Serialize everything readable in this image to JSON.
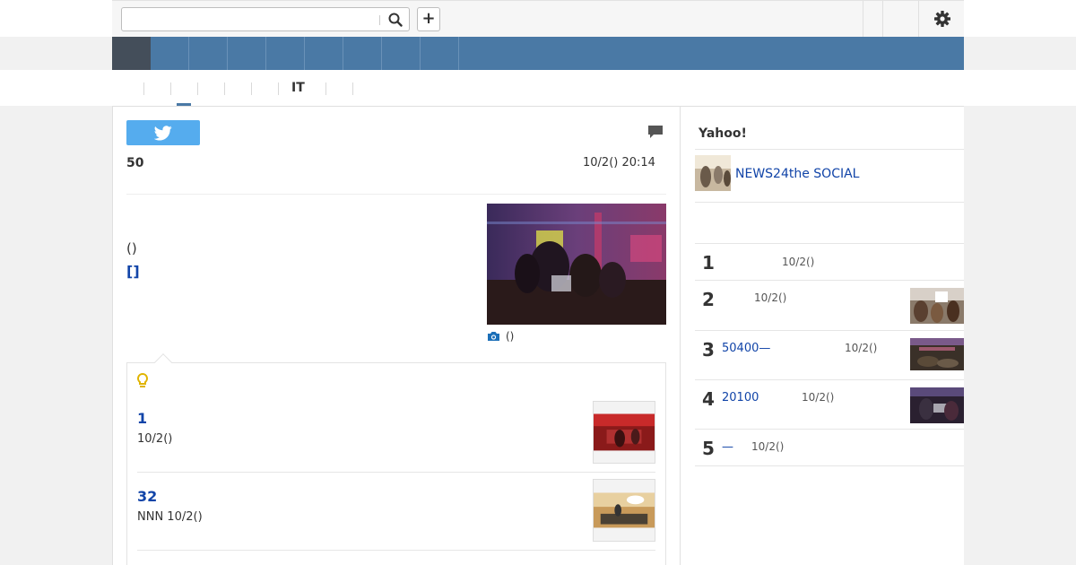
{
  "header": {
    "search": {
      "value": "",
      "placeholder": ""
    },
    "search_icon": "search-icon",
    "add_label": "+",
    "settings_icon": "gear-icon"
  },
  "nav": {
    "active_index": 0,
    "items": [
      "",
      "",
      "",
      "",
      "",
      "",
      "",
      "",
      ""
    ]
  },
  "subnav": {
    "items": [
      "",
      "",
      "",
      "",
      "",
      "IT",
      "",
      ""
    ],
    "active_index": 1
  },
  "article": {
    "share_icon": "twitter-icon",
    "comment_icon": "comment-icon",
    "title": "50",
    "timestamp": "10/2() 20:14",
    "body_text": "()",
    "body_link": "[]",
    "photo_caption": "()",
    "photo_icon": "camera-icon"
  },
  "related": {
    "icon": "lightbulb-icon",
    "items": [
      {
        "title": "1",
        "meta": " 10/2()"
      },
      {
        "title": "32",
        "meta": "NNN 10/2()"
      }
    ]
  },
  "sidebar": {
    "heading": "Yahoo!",
    "feature_link": "NEWS24the SOCIAL",
    "ranking": [
      {
        "rank": "1",
        "title": "",
        "date": "10/2()"
      },
      {
        "rank": "2",
        "title": "",
        "date": "10/2()"
      },
      {
        "rank": "3",
        "title": "50400—",
        "date": "10/2()"
      },
      {
        "rank": "4",
        "title": "20100",
        "date": "10/2()"
      },
      {
        "rank": "5",
        "title": "—",
        "date": "10/2()"
      }
    ]
  },
  "colors": {
    "nav_blue": "#4a79a5",
    "nav_active": "#444e5a",
    "link_blue": "#1144a8",
    "twitter_blue": "#55acee"
  }
}
